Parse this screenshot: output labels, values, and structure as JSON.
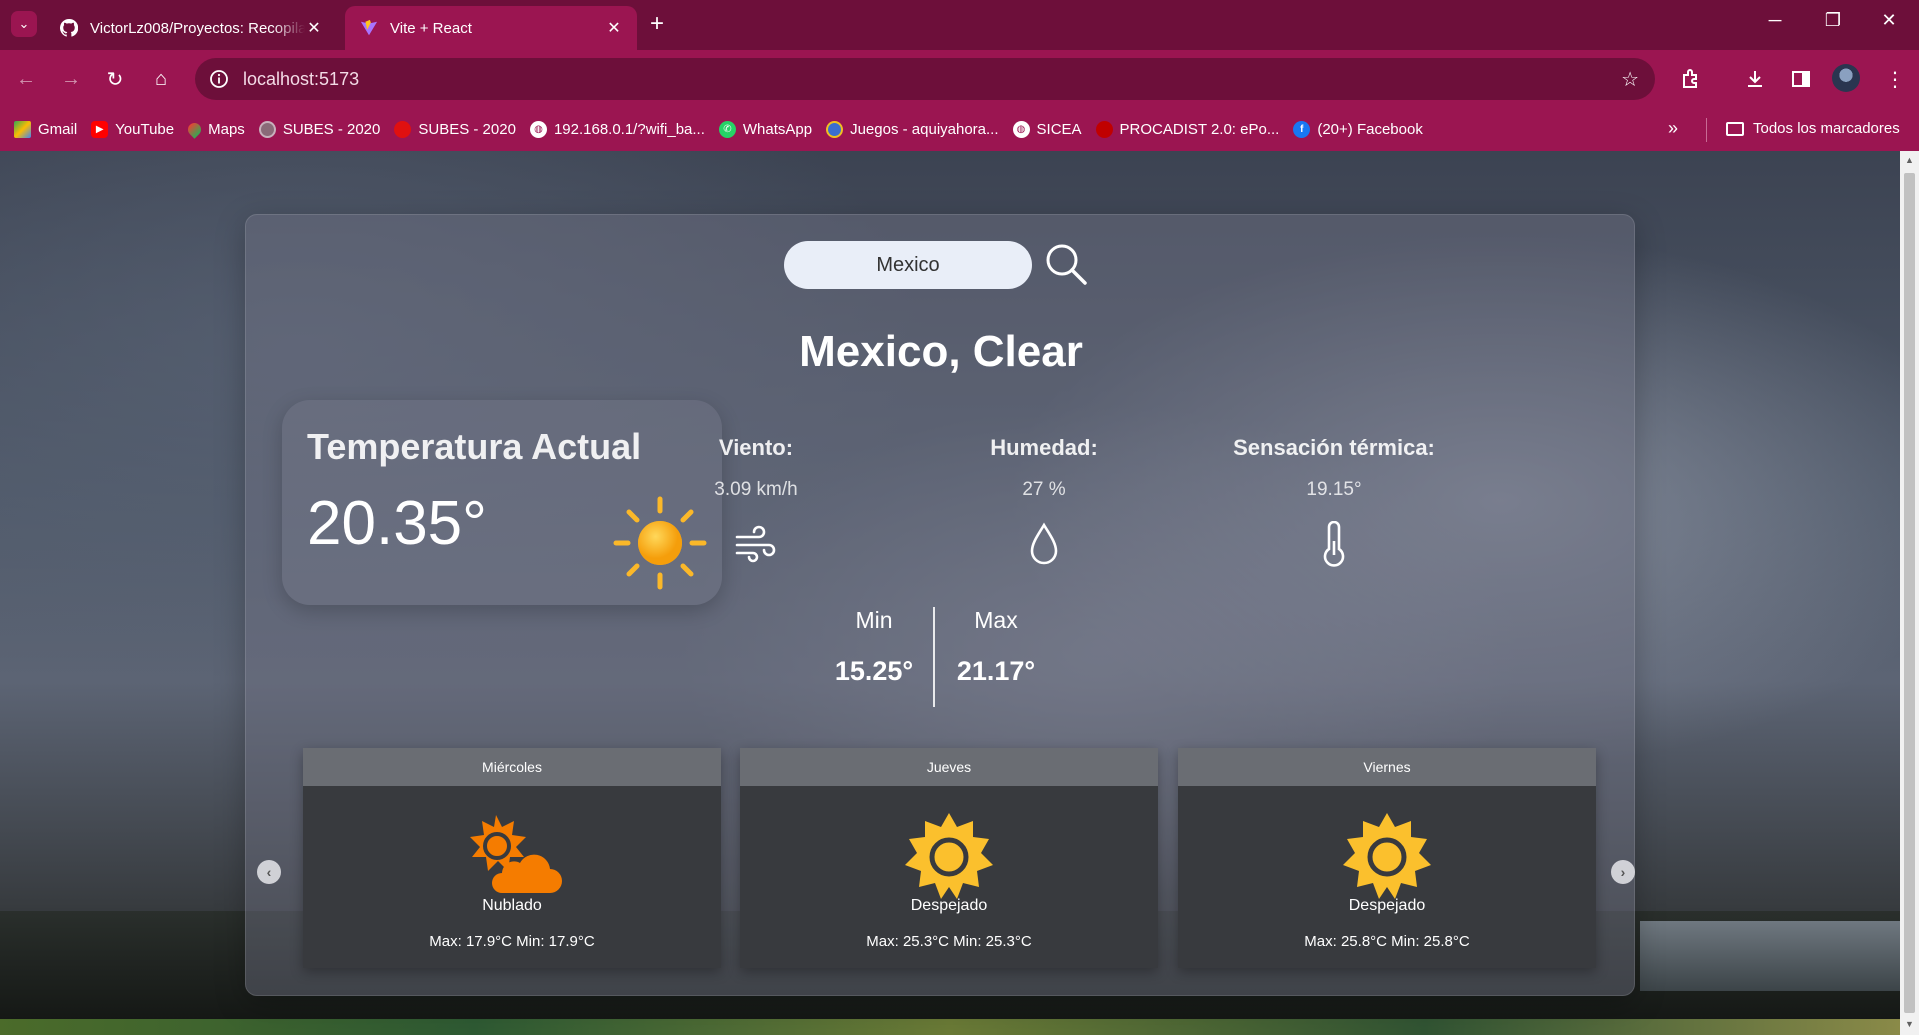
{
  "browser": {
    "tabs": [
      {
        "title": "VictorLz008/Proyectos: Recopila",
        "icon": "github-icon",
        "active": false
      },
      {
        "title": "Vite + React",
        "icon": "vite-icon",
        "active": true
      }
    ],
    "address": "localhost:5173",
    "bookmarks": [
      {
        "label": "Gmail",
        "icon": "google-drive-icon",
        "color": "#f4b400"
      },
      {
        "label": "YouTube",
        "icon": "youtube-icon",
        "color": "#ff0000"
      },
      {
        "label": "Maps",
        "icon": "maps-icon",
        "color": "#34a853"
      },
      {
        "label": "SUBES - 2020",
        "icon": "subes-seal-icon",
        "color": "#8a6a78"
      },
      {
        "label": "SUBES - 2020",
        "icon": "red-circle-icon",
        "color": "#e01010"
      },
      {
        "label": "192.168.0.1/?wifi_ba...",
        "icon": "globe-icon",
        "color": "#ffffff"
      },
      {
        "label": "WhatsApp",
        "icon": "whatsapp-icon",
        "color": "#25d366"
      },
      {
        "label": "Juegos - aquiyahora...",
        "icon": "games-icon",
        "color": "#3b6ed0"
      },
      {
        "label": "SICEA",
        "icon": "globe-icon",
        "color": "#ffffff"
      },
      {
        "label": "PROCADIST 2.0: ePo...",
        "icon": "red-circle-icon",
        "color": "#c00000"
      },
      {
        "label": "(20+) Facebook",
        "icon": "facebook-icon",
        "color": "#1877f2"
      }
    ],
    "all_bookmarks": "Todos los marcadores"
  },
  "weather": {
    "search_value": "Mexico",
    "title": "Mexico, Clear",
    "current_label": "Temperatura Actual",
    "current_temp": "20.35°",
    "stats": [
      {
        "label": "Viento:",
        "value": "3.09 km/h",
        "icon": "wind-icon"
      },
      {
        "label": "Humedad:",
        "value": "27 %",
        "icon": "droplet-icon"
      },
      {
        "label": "Sensación térmica:",
        "value": "19.15°",
        "icon": "thermometer-icon"
      }
    ],
    "min_label": "Min",
    "min_value": "15.25°",
    "max_label": "Max",
    "max_value": "21.17°",
    "forecast": [
      {
        "day": "Miércoles",
        "condition": "Nublado",
        "range": "Max: 17.9°C   Min: 17.9°C",
        "icon": "partly-cloudy-icon"
      },
      {
        "day": "Jueves",
        "condition": "Despejado",
        "range": "Max: 25.3°C   Min: 25.3°C",
        "icon": "sun-icon"
      },
      {
        "day": "Viernes",
        "condition": "Despejado",
        "range": "Max: 25.8°C   Min: 25.8°C",
        "icon": "sun-icon"
      }
    ]
  },
  "colors": {
    "chrome_frame": "#6d0f3a",
    "chrome_toolbar": "#9b1551",
    "sun": "#fbb829",
    "forecast_icon": "#f7a200"
  }
}
